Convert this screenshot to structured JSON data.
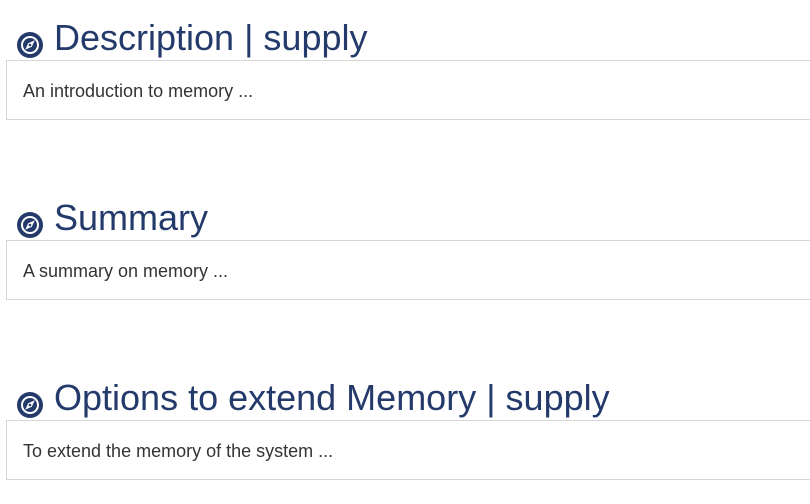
{
  "sections": [
    {
      "icon": "compass-icon",
      "title": "Description | supply",
      "content": "An introduction to memory ..."
    },
    {
      "icon": "compass-icon",
      "title": "Summary",
      "content": "A summary on memory ..."
    },
    {
      "icon": "compass-icon",
      "title": "Options to extend Memory | supply",
      "content": "To extend the memory of the system ..."
    }
  ],
  "colors": {
    "heading": "#233a6b",
    "text": "#333333",
    "border": "#d6d6d6"
  }
}
